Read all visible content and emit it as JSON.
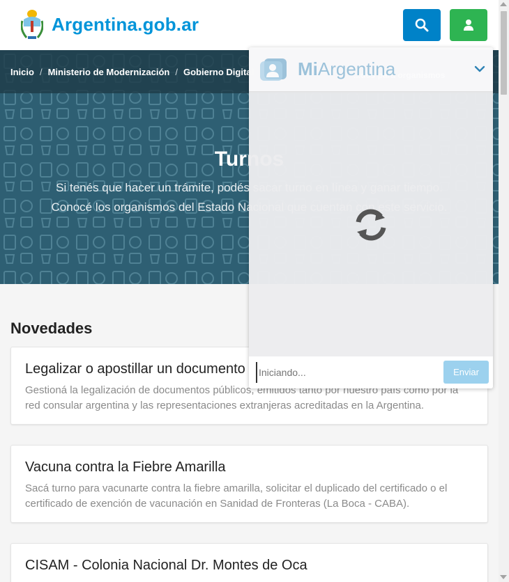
{
  "header": {
    "site_name": "Argentina.gob.ar"
  },
  "breadcrumb": {
    "items": [
      "Inicio",
      "Ministerio de Modernización",
      "Gobierno Digital"
    ]
  },
  "hero": {
    "title": "Turnos",
    "subtitle_line1": "Si tenés que hacer un trámite, podés sacar turno en línea y ganar tiempo.",
    "subtitle_line2": "Conocé los organismos del Estado Nacional que cuentan con este servicio."
  },
  "news": {
    "section_title": "Novedades",
    "cards": [
      {
        "title": "Legalizar o apostillar un documento",
        "desc": "Gestioná la legalización de documentos públicos, emitidos tanto por nuestro país como por la red consular argentina y las representaciones extranjeras acreditadas en la Argentina."
      },
      {
        "title": "Vacuna contra la Fiebre Amarilla",
        "desc": "Sacá turno para vacunarte contra la fiebre amarilla, solicitar el duplicado del certificado o el certificado de exención de vacunación en Sanidad de Fronteras (La Boca - CABA)."
      },
      {
        "title": "CISAM - Colonia Nacional Dr. Montes de Oca",
        "desc": ""
      }
    ]
  },
  "chat": {
    "brand_prefix": "Mi",
    "brand_suffix": "Argentina",
    "ghost_text": "...dos para organismos",
    "input_placeholder": "Iniciando...",
    "send_label": "Enviar"
  },
  "colors": {
    "brand_blue": "#0094d9",
    "search_button": "#0082c8",
    "user_button": "#2eb452",
    "hero_bg": "#2e5f73",
    "send_button": "#9cd1ee"
  },
  "icons": [
    "coat-of-arms-icon",
    "search-icon",
    "user-icon",
    "miargentina-logo-icon",
    "chevron-down-icon",
    "refresh-spinner-icon"
  ]
}
